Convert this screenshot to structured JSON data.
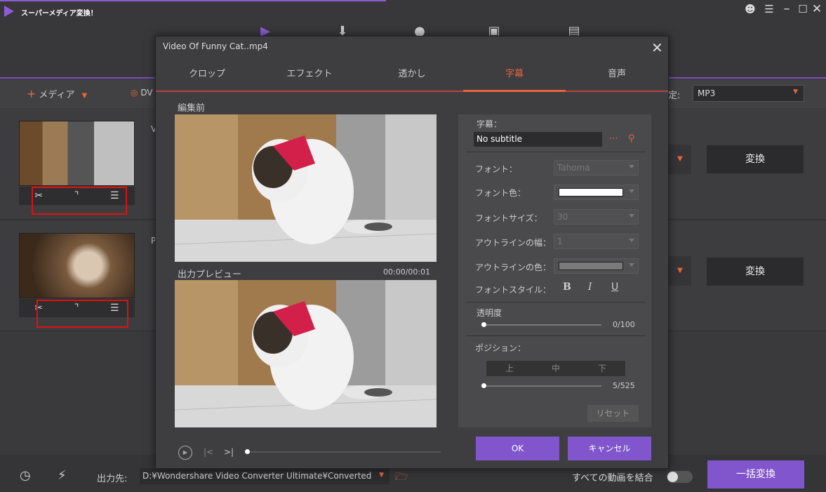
{
  "app": {
    "title": "スーパーメディア変換！"
  },
  "toolbar": {
    "add_media": "メディア",
    "dvd": "DV",
    "format_label_partial": "定:",
    "format_value": "MP3"
  },
  "rows": [
    {
      "tag": "V",
      "convert_label": "変換"
    },
    {
      "tag": "P",
      "convert_label": "変換"
    }
  ],
  "bottom": {
    "output_label": "出力先:",
    "output_path": "D:¥Wondershare Video Converter Ultimate¥Converted",
    "merge_label": "すべての動画を結合",
    "batch_convert": "一括変換"
  },
  "dialog": {
    "title": "Video Of Funny Cat..mp4",
    "tabs": [
      "クロップ",
      "エフェクト",
      "透かし",
      "字幕",
      "音声"
    ],
    "active_tab": "字幕",
    "before_label": "編集前",
    "after_label": "出力プレビュー",
    "timecode": "00:00/00:01",
    "panel": {
      "subtitle_label": "字幕：",
      "subtitle_value": "No subtitle",
      "font_label": "フォント：",
      "font_value": "Tahoma",
      "font_color_label": "フォント色：",
      "font_color": "#ffffff",
      "font_size_label": "フォントサイズ：",
      "font_size_value": "30",
      "outline_width_label": "アウトラインの幅：",
      "outline_width_value": "1",
      "outline_color_label": "アウトラインの色：",
      "outline_color": "#7a7a7a",
      "font_style_label": "フォントスタイル：",
      "bold": "B",
      "italic": "I",
      "underline": "U",
      "opacity_label": "透明度",
      "opacity_value": "0/100",
      "position_label": "ポジション：",
      "position_options": [
        "上",
        "中",
        "下"
      ],
      "position_value": "5/525",
      "reset": "リセット"
    },
    "ok": "OK",
    "cancel": "キャンセル"
  },
  "colors": {
    "accent": "#8155cc",
    "orange": "#e8643c",
    "highlight_box": "#e01010"
  }
}
